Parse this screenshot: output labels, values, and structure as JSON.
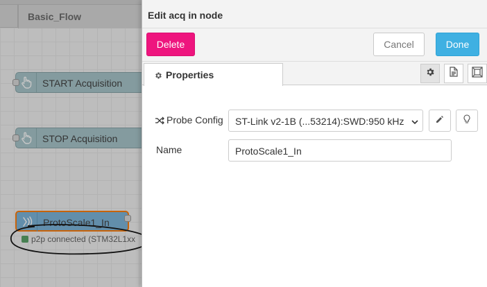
{
  "workspace": {
    "tab_label": "Basic_Flow",
    "nodes": [
      {
        "label": "START Acquisition",
        "icon": "hand-pointer-icon"
      },
      {
        "label": "STOP Acquisition",
        "icon": "hand-pointer-icon"
      },
      {
        "label": "ProtoScale1_In",
        "icon": "wireless-signal-icon"
      }
    ],
    "status_text": "p2p connected (STM32L1xx",
    "status_color": "#5ba56a"
  },
  "tray": {
    "title": "Edit acq in node",
    "delete_label": "Delete",
    "cancel_label": "Cancel",
    "done_label": "Done",
    "tab_properties": "Properties",
    "probe_config_label": "Probe Config",
    "probe_config_value": "ST-Link v2-1B (...53214):SWD:950 kHz",
    "name_label": "Name",
    "name_value": "ProtoScale1_In"
  },
  "colors": {
    "delete": "#ee157e",
    "done": "#3fb0e2",
    "node_selected_border": "#ff7f0e"
  }
}
